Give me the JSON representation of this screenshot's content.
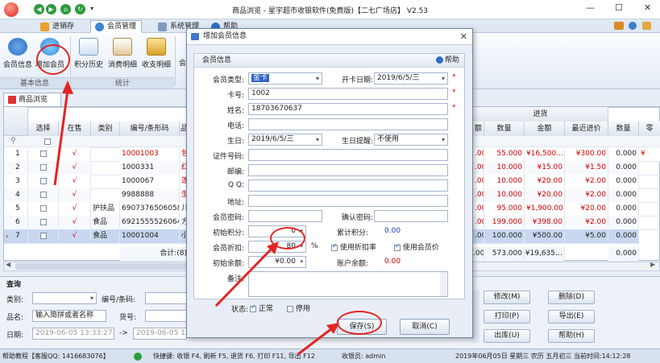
{
  "window": {
    "title": "商品浏览 - 星宇超市收银软件(免费版)【二七广场店】 V2.53",
    "min": "—",
    "max": "☐",
    "close": "✕"
  },
  "menu": {
    "tabs": [
      "进销存",
      "会员管理",
      "系统管理",
      "帮助"
    ]
  },
  "ribbon": {
    "group1": {
      "label": "基本信息",
      "buttons": [
        "会员信息",
        "增加会员"
      ]
    },
    "group2": {
      "label": "统计",
      "buttons": [
        "积分历史",
        "消费明细",
        "收支明细"
      ]
    },
    "truncated": "会"
  },
  "doc_tab": "商品浏览",
  "grid": {
    "headers": [
      "选择",
      "在售",
      "类别",
      "编号/条形码",
      "品"
    ],
    "right_group": "进货",
    "right_headers": [
      "额",
      "数量",
      "金额",
      "最近进价",
      "数量",
      "零"
    ],
    "rows": [
      {
        "n": "1",
        "check": "√",
        "cat": "",
        "code": "10001003",
        "p": "包",
        "red": true,
        "a": ".00",
        "q": "55.000",
        "amt": "¥16,500.…",
        "price": "¥300.00",
        "q2": "0.000",
        "z": "¥"
      },
      {
        "n": "2",
        "check": "√",
        "cat": "",
        "code": "1000331",
        "p": "红",
        "red": false,
        "a": ".00",
        "q": "10.000",
        "amt": "¥15.00",
        "price": "¥1.50",
        "q2": "0.000",
        "z": ""
      },
      {
        "n": "3",
        "check": "√",
        "cat": "",
        "code": "1000067",
        "p": "莲",
        "red": false,
        "a": ".00",
        "q": "10.000",
        "amt": "¥20.00",
        "price": "¥2.00",
        "q2": "0.000",
        "z": ""
      },
      {
        "n": "4",
        "check": "√",
        "cat": "",
        "code": "9988888",
        "p": "生",
        "red": false,
        "a": ".00",
        "q": "10.000",
        "amt": "¥20.00",
        "price": "¥2.00",
        "q2": "0.000",
        "z": ""
      },
      {
        "n": "5",
        "check": "√",
        "cat": "护扶品",
        "code": "6907376506058",
        "p": "儿",
        "red": false,
        "a": ".00",
        "q": "95.000",
        "amt": "¥1,900.00",
        "price": "¥20.00",
        "q2": "0.000",
        "z": ""
      },
      {
        "n": "6",
        "check": "√",
        "cat": "食品",
        "code": "6921555526064",
        "p": "方",
        "red": false,
        "a": ".00",
        "q": "199.000",
        "amt": "¥398.00",
        "price": "¥2.00",
        "q2": "0.000",
        "z": ""
      },
      {
        "n": "7",
        "check": "√",
        "cat": "食品",
        "code": "10001004",
        "p": "小",
        "red": false,
        "a": ".00",
        "q": "100.000",
        "amt": "¥500.00",
        "price": "¥5.00",
        "q2": "0.000",
        "z": ""
      }
    ],
    "total_label": "合计:(8)",
    "total": {
      "a": ".00",
      "q": "573.000",
      "amt": "¥19,635…",
      "q2": "0.000"
    }
  },
  "query": {
    "title": "查询",
    "labels": {
      "cat": "类别:",
      "code": "编号/条码:",
      "name": "品名:",
      "goods_no": "货号:",
      "date": "日期:"
    },
    "name_placeholder": "输入简拼或者名称",
    "date_from": "2019-06-05 13:33:27",
    "date_to": "2019-06-05 13:",
    "arrow": "->",
    "buttons": [
      "修改(M)",
      "删除(D)",
      "打印(P)",
      "导出(E)",
      "出库(U)",
      "帮助(H)"
    ]
  },
  "status": {
    "help": "帮助教程【客服QQ: 1416683076】",
    "shortcuts": "快捷键: 收银 F4, 刷新 F5, 退货 F6, 打印 F11, 导出 F12",
    "cashier": "收银员: admin",
    "datetime": "2019年06月05日 星期三 农历 五月初三 当前时间:14:12:28"
  },
  "dialog": {
    "title": "增加会员信息",
    "close": "✕",
    "panel": "会员信息",
    "help": "帮助",
    "labels": {
      "type": "会员类型:",
      "open": "开卡日期:",
      "card": "卡号:",
      "name": "姓名:",
      "phone": "电话:",
      "birthday": "生日:",
      "remind": "生日提醒:",
      "id": "证件号码:",
      "zip": "邮编:",
      "qq": "Q Q:",
      "addr": "地址:",
      "pwd": "会员密码:",
      "pwd2": "确认密码:",
      "init_points": "初始积分:",
      "acc_points": "累计积分:",
      "discount": "会员折扣:",
      "init_balance": "初始余额:",
      "balance": "账户余额:",
      "remark": "备注:",
      "status": "状态:"
    },
    "values": {
      "type": "金卡",
      "open": "2019/6/5/三",
      "card": "1002",
      "name": "18703670637",
      "birthday": "2019/6/5/三",
      "remind": "不使用",
      "init_points": "0",
      "acc_points": "0.00",
      "discount": "80",
      "pct": "%",
      "use_rate": "使用折扣率",
      "use_price": "使用会员价",
      "init_balance": "¥0.00",
      "balance": "0.00",
      "normal": "正常",
      "disabled": "停用"
    },
    "save": "保存(S)",
    "cancel": "取消(C)"
  }
}
